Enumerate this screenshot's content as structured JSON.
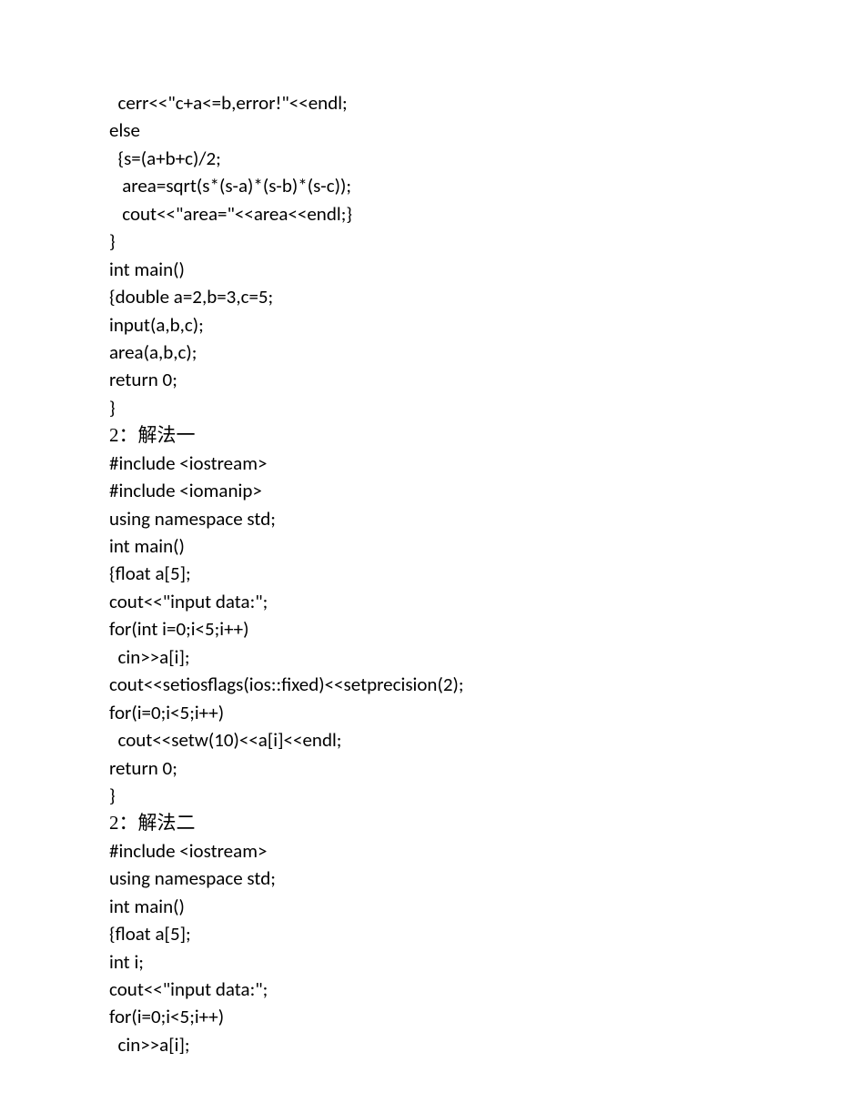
{
  "lines": [
    "  cerr<<\"c+a<=b,error!\"<<endl;",
    "else",
    "  {s=(a+b+c)/2;",
    "   area=sqrt(s*(s-a)*(s-b)*(s-c));",
    "   cout<<\"area=\"<<area<<endl;}",
    "}",
    "int main()",
    "{double a=2,b=3,c=5;",
    "input(a,b,c);",
    "area(a,b,c);",
    "return 0;",
    "}",
    "2：解法一",
    "#include <iostream>",
    "#include <iomanip>",
    "using namespace std;",
    "",
    "int main()",
    "{float a[5];",
    "cout<<\"input data:\";",
    "for(int i=0;i<5;i++)",
    "  cin>>a[i];",
    "cout<<setiosflags(ios::fixed)<<setprecision(2);",
    "for(i=0;i<5;i++)",
    "  cout<<setw(10)<<a[i]<<endl;",
    "return 0;",
    "}",
    "2：解法二",
    "#include <iostream>",
    "using namespace std;",
    "int main()",
    "{float a[5];",
    "int i;",
    "cout<<\"input data:\";",
    "for(i=0;i<5;i++)",
    "  cin>>a[i];"
  ]
}
